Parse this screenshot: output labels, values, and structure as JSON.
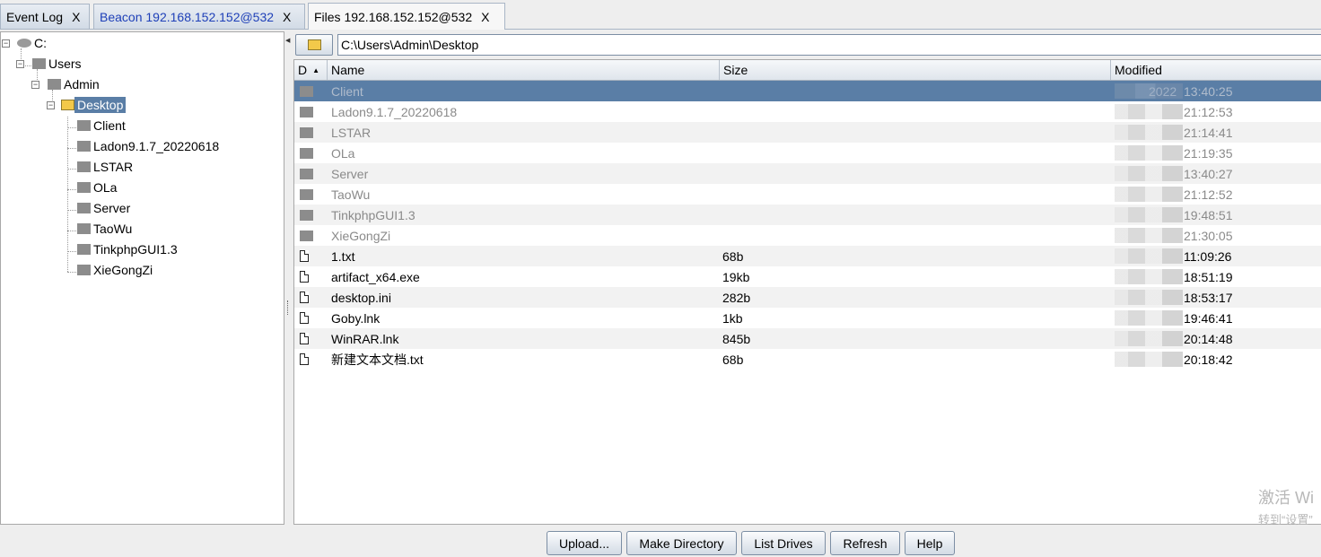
{
  "tabs": [
    {
      "label": "Event Log",
      "close": "X"
    },
    {
      "label": "Beacon 192.168.152.152@532",
      "close": "X"
    },
    {
      "label": "Files 192.168.152.152@532",
      "close": "X"
    }
  ],
  "tree": {
    "drive": "C:",
    "users": "Users",
    "admin": "Admin",
    "desktop": "Desktop",
    "children": [
      "Client",
      "Ladon9.1.7_20220618",
      "LSTAR",
      "OLa",
      "Server",
      "TaoWu",
      "TinkphpGUI1.3",
      "XieGongZi"
    ]
  },
  "path": {
    "value": "C:\\Users\\Admin\\Desktop"
  },
  "grid": {
    "headers": {
      "d": "D",
      "sort_indicator": "▲",
      "name": "Name",
      "size": "Size",
      "modified": "Modified"
    },
    "partial_date_first_row": "2022",
    "rows": [
      {
        "type": "dir",
        "name": "Client",
        "size": "",
        "time": "13:40:25"
      },
      {
        "type": "dir",
        "name": "Ladon9.1.7_20220618",
        "size": "",
        "time": "21:12:53"
      },
      {
        "type": "dir",
        "name": "LSTAR",
        "size": "",
        "time": "21:14:41"
      },
      {
        "type": "dir",
        "name": "OLa",
        "size": "",
        "time": "21:19:35"
      },
      {
        "type": "dir",
        "name": "Server",
        "size": "",
        "time": "13:40:27"
      },
      {
        "type": "dir",
        "name": "TaoWu",
        "size": "",
        "time": "21:12:52"
      },
      {
        "type": "dir",
        "name": "TinkphpGUI1.3",
        "size": "",
        "time": "19:48:51"
      },
      {
        "type": "dir",
        "name": "XieGongZi",
        "size": "",
        "time": "21:30:05"
      },
      {
        "type": "file",
        "name": "1.txt",
        "size": "68b",
        "time": "11:09:26"
      },
      {
        "type": "file",
        "name": "artifact_x64.exe",
        "size": "19kb",
        "time": "18:51:19"
      },
      {
        "type": "file",
        "name": "desktop.ini",
        "size": "282b",
        "time": "18:53:17"
      },
      {
        "type": "file",
        "name": "Goby.lnk",
        "size": "1kb",
        "time": "19:46:41"
      },
      {
        "type": "file",
        "name": "WinRAR.lnk",
        "size": "845b",
        "time": "20:14:48"
      },
      {
        "type": "file",
        "name": "新建文本文档.txt",
        "size": "68b",
        "time": "20:18:42"
      }
    ]
  },
  "buttons": {
    "upload": "Upload...",
    "make_directory": "Make Directory",
    "list_drives": "List Drives",
    "refresh": "Refresh",
    "help": "Help"
  },
  "watermark": {
    "line1": "激活 Wi",
    "line2": "转到“设置”"
  },
  "colors": {
    "selection": "#5a7ea6",
    "tab_link": "#1e3fb8",
    "dir_text": "#8a8a8a"
  }
}
